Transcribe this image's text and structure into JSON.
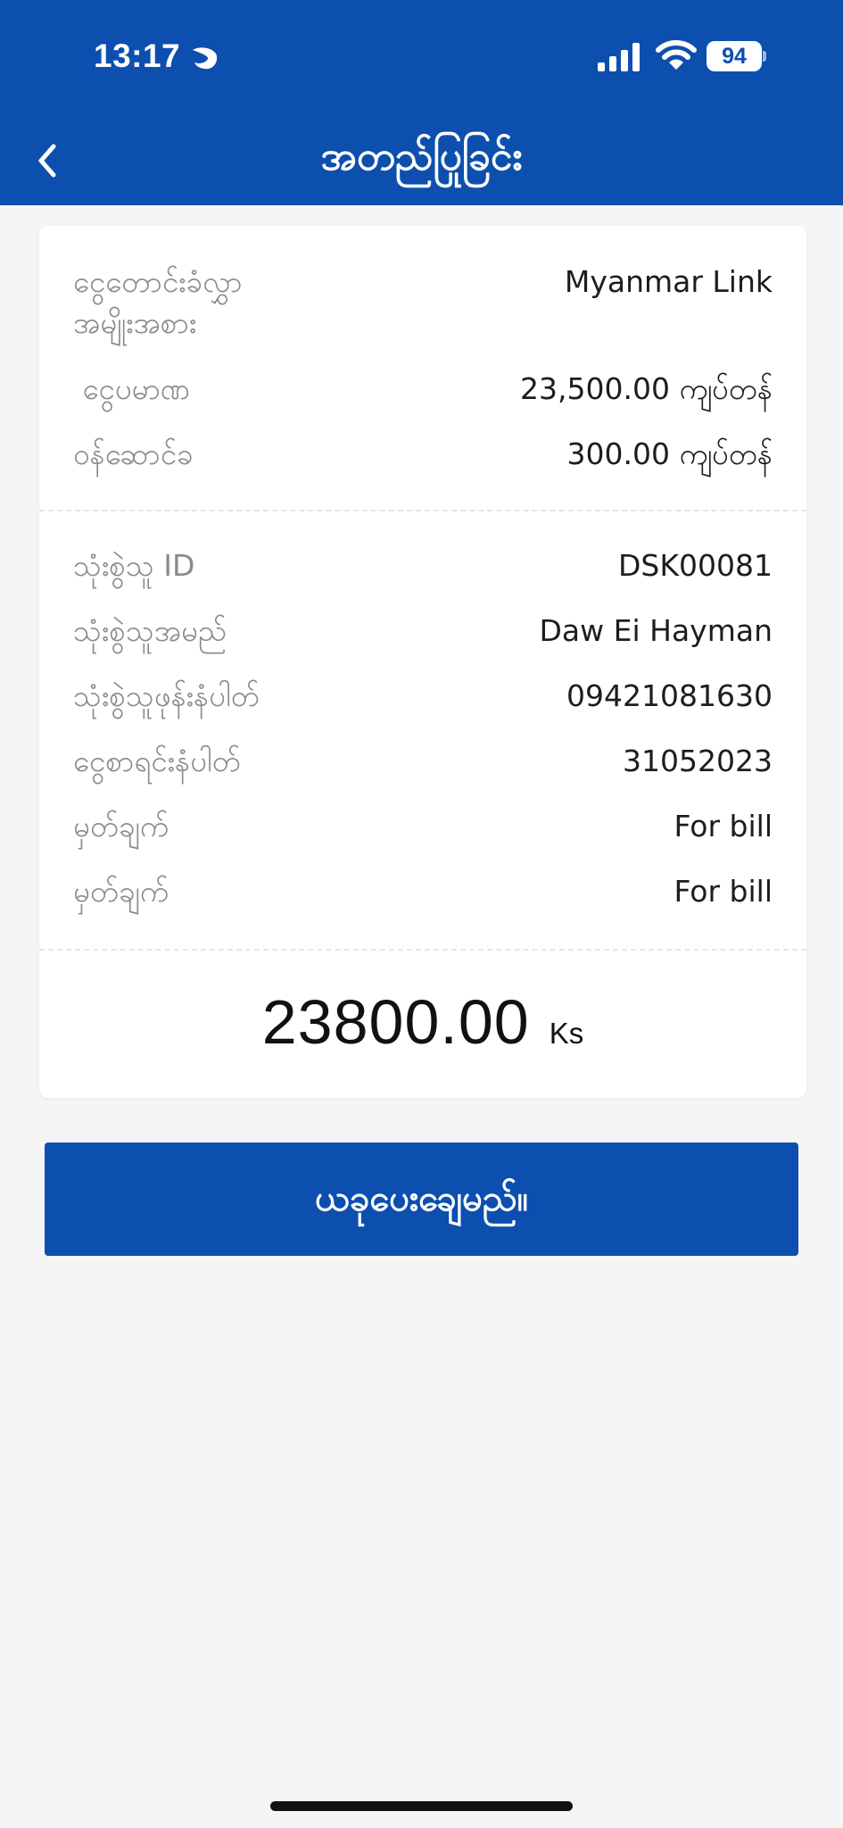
{
  "status_bar": {
    "time": "13:17",
    "battery": "94",
    "icons": [
      "focus-moon-icon",
      "signal-icon",
      "wifi-icon",
      "battery-icon"
    ]
  },
  "header": {
    "title": "အတည်ပြုခြင်း",
    "back_icon": "chevron-left-icon",
    "background_color": "#0d4faf"
  },
  "details": {
    "transfer_type_label": "ငွေတောင်းခံလွှာ\nအမျိုးအစား",
    "transfer_type_value": "Myanmar Link",
    "amount_label": " ငွေပမာဏ",
    "amount_value": "23,500.00 ကျပ်တန်",
    "fee_label": "ဝန်ဆောင်ခ",
    "fee_value": "300.00 ကျပ်တန်",
    "user_id_label": "သုံးစွဲသူ ID",
    "user_id_value": "DSK00081",
    "user_name_label": "သုံးစွဲသူအမည်",
    "user_name_value": "Daw Ei Hayman",
    "phone_label": "သုံးစွဲသူဖုန်းနံပါတ်",
    "phone_value": "09421081630",
    "account_label": "ငွေစာရင်းနံပါတ်",
    "account_value": "31052023",
    "note1_label": "မှတ်ချက်",
    "note1_value": "For bill",
    "note2_label": "မှတ်ချက်",
    "note2_value": "For bill"
  },
  "total": {
    "amount": "23800.00",
    "currency": "Ks"
  },
  "pay_button": {
    "label": "ယခုပေးချေမည်။"
  }
}
